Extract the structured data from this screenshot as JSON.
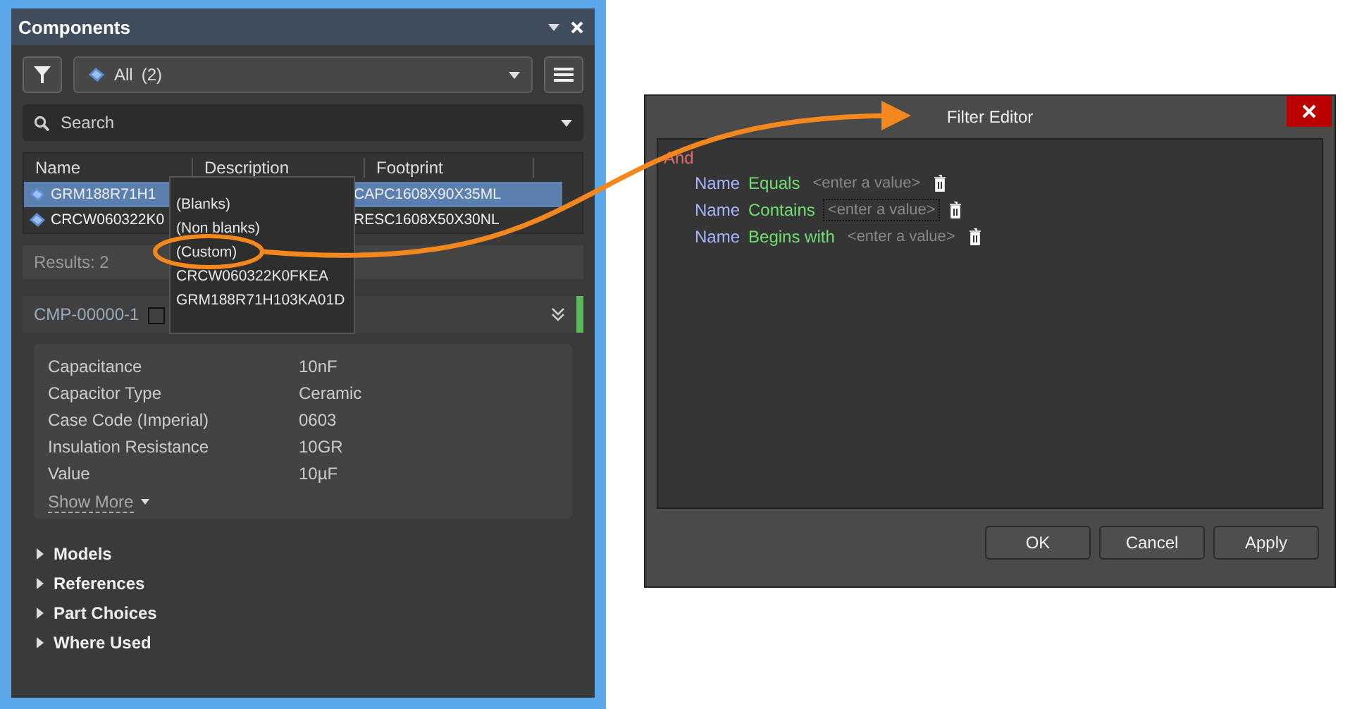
{
  "panel": {
    "title": "Components",
    "filter": {
      "value": "All",
      "count": "(2)"
    },
    "search": {
      "placeholder": "Search"
    },
    "table": {
      "columns": [
        {
          "label": "Name"
        },
        {
          "label": "Description"
        },
        {
          "label": "Footprint"
        }
      ],
      "rows": [
        {
          "name": "GRM188R71H1",
          "footprint": "CAPC1608X90X35ML",
          "selected": true
        },
        {
          "name": "CRCW060322K0",
          "footprint": "RESC1608X50X30NL",
          "selected": false
        }
      ]
    },
    "results": "Results: 2",
    "popup": {
      "items": [
        {
          "label": "(Blanks)",
          "circled": false
        },
        {
          "label": "(Non blanks)",
          "circled": false
        },
        {
          "label": "(Custom)",
          "circled": true
        },
        {
          "label": "CRCW060322K0FKEA",
          "circled": false
        },
        {
          "label": "GRM188R71H103KA01D",
          "circled": false
        }
      ]
    },
    "component": {
      "id": "CMP-00000-1",
      "properties": [
        {
          "name": "Capacitance",
          "value": "10nF"
        },
        {
          "name": "Capacitor Type",
          "value": "Ceramic"
        },
        {
          "name": "Case Code (Imperial)",
          "value": "0603"
        },
        {
          "name": "Insulation Resistance",
          "value": "10GR"
        },
        {
          "name": "Value",
          "value": "10µF"
        }
      ],
      "show_more": "Show More",
      "sections": [
        {
          "label": "Models",
          "expanded": false
        },
        {
          "label": "References",
          "expanded": false
        },
        {
          "label": "Part Choices",
          "expanded": false
        },
        {
          "label": "Where Used",
          "expanded": false
        }
      ]
    }
  },
  "dialog": {
    "title": "Filter Editor",
    "operator": "And",
    "conditions": [
      {
        "field": "Name",
        "operator": "Equals",
        "placeholder": "<enter a value>",
        "focused": false
      },
      {
        "field": "Name",
        "operator": "Contains",
        "placeholder": "<enter a value>",
        "focused": true
      },
      {
        "field": "Name",
        "operator": "Begins with",
        "placeholder": "<enter a value>",
        "focused": false
      }
    ],
    "buttons": [
      "OK",
      "Cancel",
      "Apply"
    ]
  }
}
